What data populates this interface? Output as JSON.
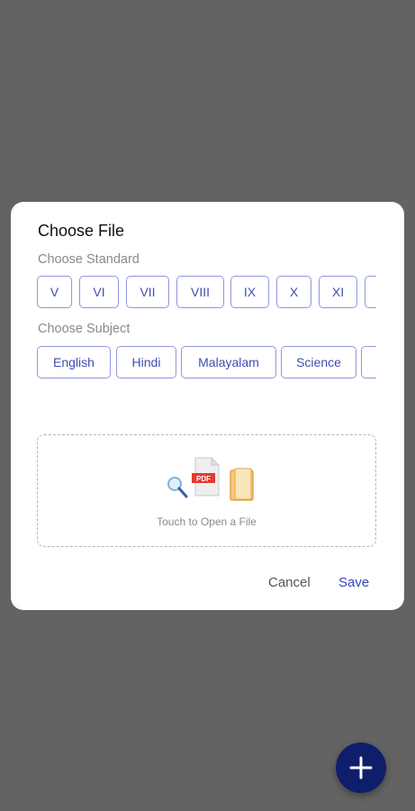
{
  "dialog": {
    "title": "Choose File",
    "standard_label": "Choose Standard",
    "standards": [
      "V",
      "VI",
      "VII",
      "VIII",
      "IX",
      "X",
      "XI"
    ],
    "subject_label": "Choose Subject",
    "subjects": [
      "English",
      "Hindi",
      "Malayalam",
      "Science"
    ],
    "dropzone_text": "Touch to Open a File",
    "dropzone_icons": [
      "magnifier-icon",
      "pdf-file-icon",
      "document-icon"
    ],
    "pdf_badge": "PDF",
    "cancel_label": "Cancel",
    "save_label": "Save"
  },
  "fab": {
    "icon": "plus-icon"
  },
  "colors": {
    "backdrop": "#636363",
    "accent": "#3f4db0",
    "chip_border": "#8f97dc",
    "fab": "#0f1e6b"
  }
}
